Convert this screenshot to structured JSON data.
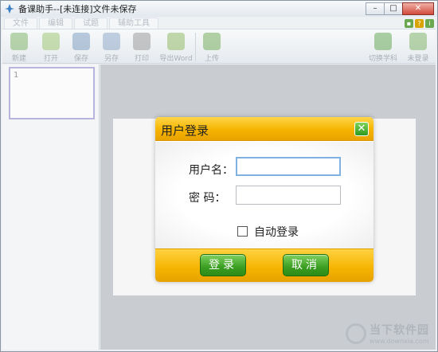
{
  "window": {
    "title": "备课助手--[未连接]文件未保存",
    "controls": {
      "minimize": "–",
      "maximize": "□",
      "close": "✕"
    }
  },
  "menu": {
    "tabs": [
      "文件",
      "编辑",
      "试题",
      "辅助工具"
    ],
    "right_icons": [
      "app-icon",
      "help-icon",
      "info-icon"
    ]
  },
  "toolbar": {
    "left_tools": [
      {
        "label": "新建",
        "icon": "new-icon",
        "color": "#6aa84f"
      },
      {
        "label": "打开",
        "icon": "open-icon",
        "color": "#8fbf5a"
      },
      {
        "label": "保存",
        "icon": "save-icon",
        "color": "#6b8fb8"
      },
      {
        "label": "另存",
        "icon": "save-as-icon",
        "color": "#7d9cc0"
      },
      {
        "label": "打印",
        "icon": "print-icon",
        "color": "#8a8a8a"
      },
      {
        "label": "导出Word",
        "icon": "export-word-icon",
        "color": "#7fb04a"
      },
      {
        "label": "上传",
        "icon": "upload-icon",
        "color": "#5ea03e"
      }
    ],
    "right_tools": [
      {
        "label": "切换学科",
        "icon": "switch-subject-icon",
        "color": "#4d9c3a"
      },
      {
        "label": "未登录",
        "icon": "user-icon",
        "color": "#6aa84f"
      }
    ]
  },
  "slides": {
    "thumbnail_number": "1"
  },
  "dialog": {
    "title": "用户登录",
    "close_icon": "✕",
    "username_label": "用户名：",
    "username_value": "",
    "password_label": "密  码：",
    "password_value": "",
    "auto_login_label": "自动登录",
    "auto_login_checked": false,
    "login_button": "登录",
    "cancel_button": "取消"
  },
  "watermark": {
    "main": "当下软件园",
    "sub": "www.downxia.com"
  }
}
